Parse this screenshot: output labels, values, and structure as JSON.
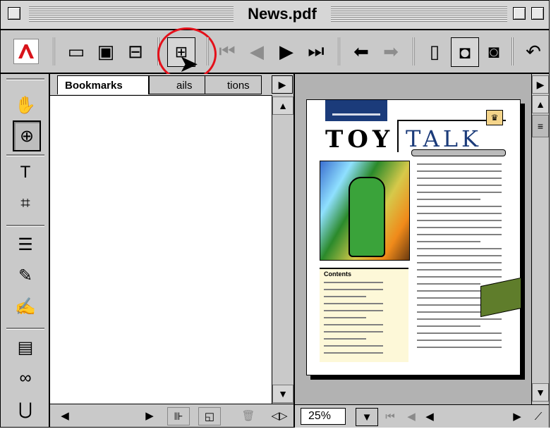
{
  "window": {
    "title": "News.pdf"
  },
  "toolbar": {
    "app_logo": "acrobat-logo",
    "items": [
      {
        "name": "open-button",
        "icon": "folder-icon",
        "glyph": "🗀"
      },
      {
        "name": "save-button",
        "icon": "disk-icon",
        "glyph": "💾"
      },
      {
        "name": "print-button",
        "icon": "printer-icon",
        "glyph": "🖶"
      },
      {
        "name": "show-navigation-pane-button",
        "icon": "pane-icon",
        "glyph": "▣"
      },
      {
        "name": "first-page-button",
        "icon": "first-page-icon",
        "glyph": "⏮"
      },
      {
        "name": "previous-page-button",
        "icon": "previous-page-icon",
        "glyph": "◀"
      },
      {
        "name": "next-page-button",
        "icon": "next-page-icon",
        "glyph": "▶"
      },
      {
        "name": "last-page-button",
        "icon": "last-page-icon",
        "glyph": "⏭"
      },
      {
        "name": "go-back-button",
        "icon": "back-arrow-icon",
        "glyph": "⬅"
      },
      {
        "name": "go-forward-button",
        "icon": "forward-arrow-icon",
        "glyph": "➡"
      },
      {
        "name": "actual-size-button",
        "icon": "page-icon",
        "glyph": "🗋"
      },
      {
        "name": "fit-page-button",
        "icon": "fit-page-icon",
        "glyph": "⧉"
      },
      {
        "name": "fit-width-button",
        "icon": "fit-width-icon",
        "glyph": "🗐"
      },
      {
        "name": "rotate-button",
        "icon": "rotate-icon",
        "glyph": "↶"
      }
    ]
  },
  "tools": [
    {
      "name": "hand-tool",
      "icon": "hand-icon",
      "glyph": "✋"
    },
    {
      "name": "zoom-tool",
      "icon": "magnifier-icon",
      "glyph": "🔍"
    },
    {
      "name": "text-select-tool",
      "icon": "text-select-icon",
      "glyph": "T⃞"
    },
    {
      "name": "crop-tool",
      "icon": "crop-icon",
      "glyph": "⌗"
    },
    {
      "name": "note-tool",
      "icon": "note-icon",
      "glyph": "🗎"
    },
    {
      "name": "pencil-tool",
      "icon": "pencil-icon",
      "glyph": "✎"
    },
    {
      "name": "highlight-tool",
      "icon": "highlighter-icon",
      "glyph": "✍"
    },
    {
      "name": "movie-tool",
      "icon": "film-icon",
      "glyph": "🎞"
    },
    {
      "name": "link-tool",
      "icon": "chain-link-icon",
      "glyph": "🔗"
    },
    {
      "name": "form-tool",
      "icon": "form-field-icon",
      "glyph": "⋃"
    }
  ],
  "panel": {
    "tabs": [
      "Bookmarks",
      "ails",
      "tions"
    ]
  },
  "status": {
    "zoom": "25%"
  },
  "page": {
    "title_left": "TOY",
    "title_right": "TALK",
    "contents_label": "Contents"
  }
}
